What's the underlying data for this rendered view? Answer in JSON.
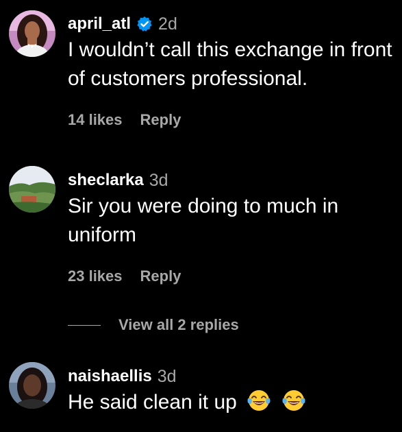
{
  "comments": [
    {
      "username": "april_atl",
      "verified": true,
      "time": "2d",
      "text": "I wouldn’t call this exchange in front of customers professional.",
      "likes": "14 likes",
      "reply_label": "Reply"
    },
    {
      "username": "sheclarka",
      "verified": false,
      "time": "3d",
      "text": "Sir you were doing to much in uniform",
      "likes": "23 likes",
      "reply_label": "Reply"
    },
    {
      "username": "naishaellis",
      "verified": false,
      "time": "3d",
      "text": "He said clean it up",
      "emoji": [
        "face-with-tears-of-joy-icon",
        "face-with-tears-of-joy-icon"
      ]
    }
  ],
  "view_replies_label": "View all 2 replies",
  "colors": {
    "background": "#000000",
    "text": "#ffffff",
    "secondary": "#a8a8a8",
    "verified": "#0095f6"
  }
}
